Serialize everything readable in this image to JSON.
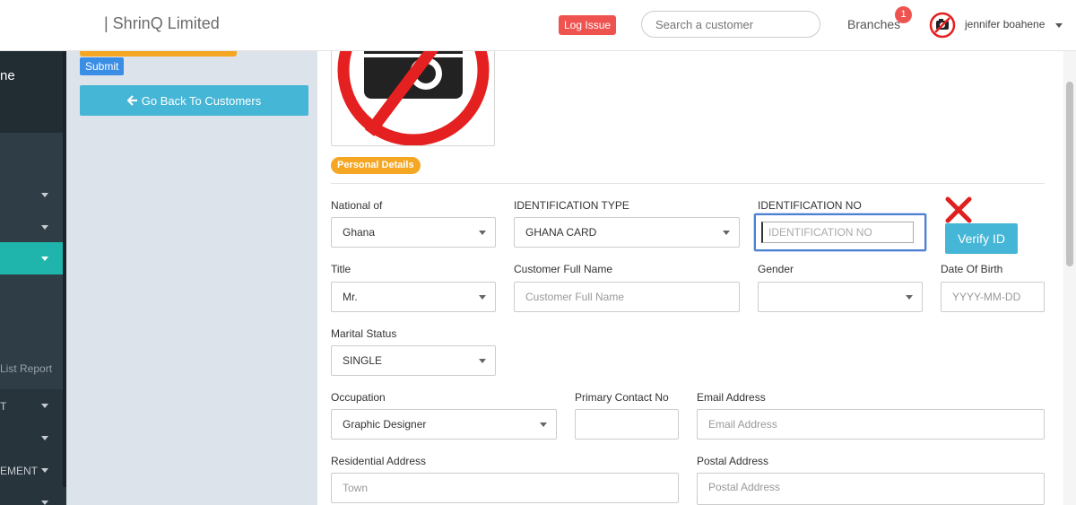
{
  "topbar": {
    "brand": "| ShrinQ Limited",
    "log_issue": "Log Issue",
    "search_placeholder": "Search a customer",
    "branches": "Branches",
    "branches_count": "1",
    "username": "jennifer boahene"
  },
  "sidebar": {
    "user_fragment": "ne",
    "items": [
      {
        "label": "List Report"
      },
      {
        "label": "T"
      },
      {
        "label": "EMENT"
      }
    ]
  },
  "leftpanel": {
    "submit": "Submit",
    "back": "Go Back To Customers"
  },
  "main": {
    "section": "Personal Details",
    "national_label": "National of",
    "national_value": "Ghana",
    "idtype_label": "IDENTIFICATION TYPE",
    "idtype_value": "GHANA CARD",
    "idno_label": "IDENTIFICATION NO",
    "idno_placeholder": "IDENTIFICATION NO",
    "verify": "Verify ID",
    "title_label": "Title",
    "title_value": "Mr.",
    "fullname_label": "Customer Full Name",
    "fullname_placeholder": "Customer Full Name",
    "gender_label": "Gender",
    "gender_value": "",
    "dob_label": "Date Of Birth",
    "dob_placeholder": "YYYY-MM-DD",
    "marital_label": "Marital Status",
    "marital_value": "SINGLE",
    "occupation_label": "Occupation",
    "occupation_value": "Graphic Designer",
    "contact_label": "Primary Contact No",
    "contact_value": "",
    "email_label": "Email Address",
    "email_placeholder": "Email Address",
    "residential_label": "Residential Address",
    "residential_placeholder": "Town",
    "postal_label": "Postal Address",
    "postal_placeholder": "Postal Address"
  },
  "colors": {
    "accent_teal": "#1fb5ac",
    "button_blue": "#45b6d6",
    "orange": "#f5a623",
    "danger": "#ef5350"
  }
}
